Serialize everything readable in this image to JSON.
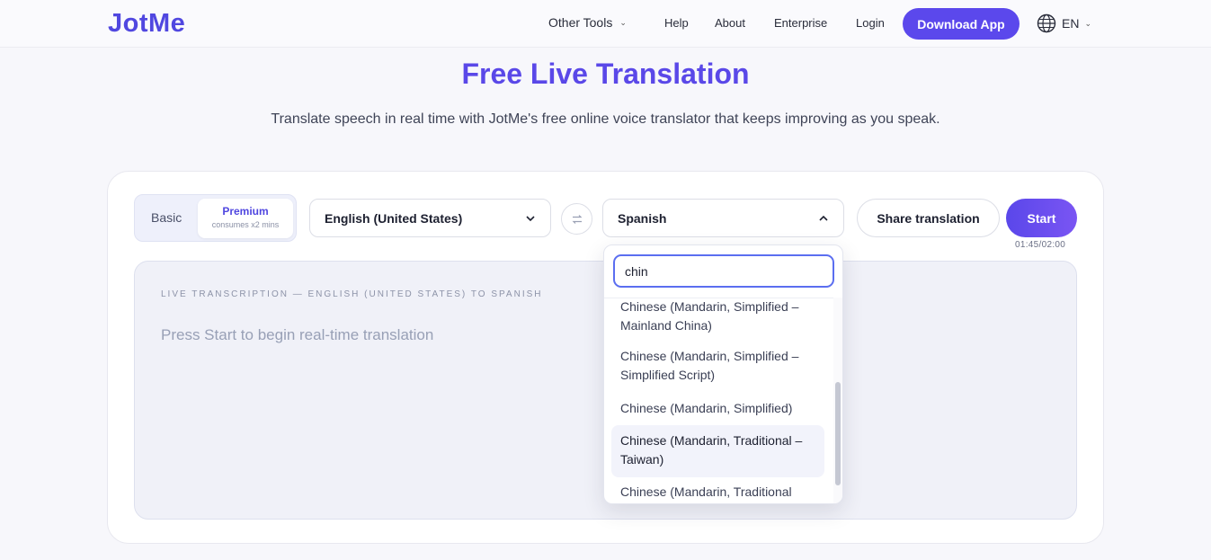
{
  "nav": {
    "logo": "JotMe",
    "other_tools": "Other Tools",
    "help": "Help",
    "about": "About",
    "enterprise": "Enterprise",
    "login": "Login",
    "download": "Download App",
    "language": "EN"
  },
  "hero": {
    "title": "Free Live Translation",
    "subtitle": "Translate speech in real time with JotMe's free online voice translator that keeps improving as you speak."
  },
  "controls": {
    "mode_basic": "Basic",
    "mode_premium": "Premium",
    "mode_premium_note": "consumes x2 mins",
    "source_language": "English (United States)",
    "target_language": "Spanish",
    "share": "Share translation",
    "start": "Start",
    "timer": "01:45/02:00"
  },
  "transcription": {
    "label": "LIVE TRANSCRIPTION — ENGLISH (UNITED STATES) TO SPANISH",
    "placeholder": "Press Start to begin real-time translation"
  },
  "dropdown": {
    "search_value": "chin",
    "options": [
      "Chinese (Mandarin, Simplified – Mainland China)",
      "Chinese (Mandarin, Simplified – Simplified Script)",
      "Chinese (Mandarin, Simplified)",
      "Chinese (Mandarin, Traditional – Taiwan)",
      "Chinese (Mandarin, Traditional"
    ],
    "active_index": 3
  },
  "colors": {
    "brand": "#5047e0",
    "accent": "#5b48ec"
  }
}
